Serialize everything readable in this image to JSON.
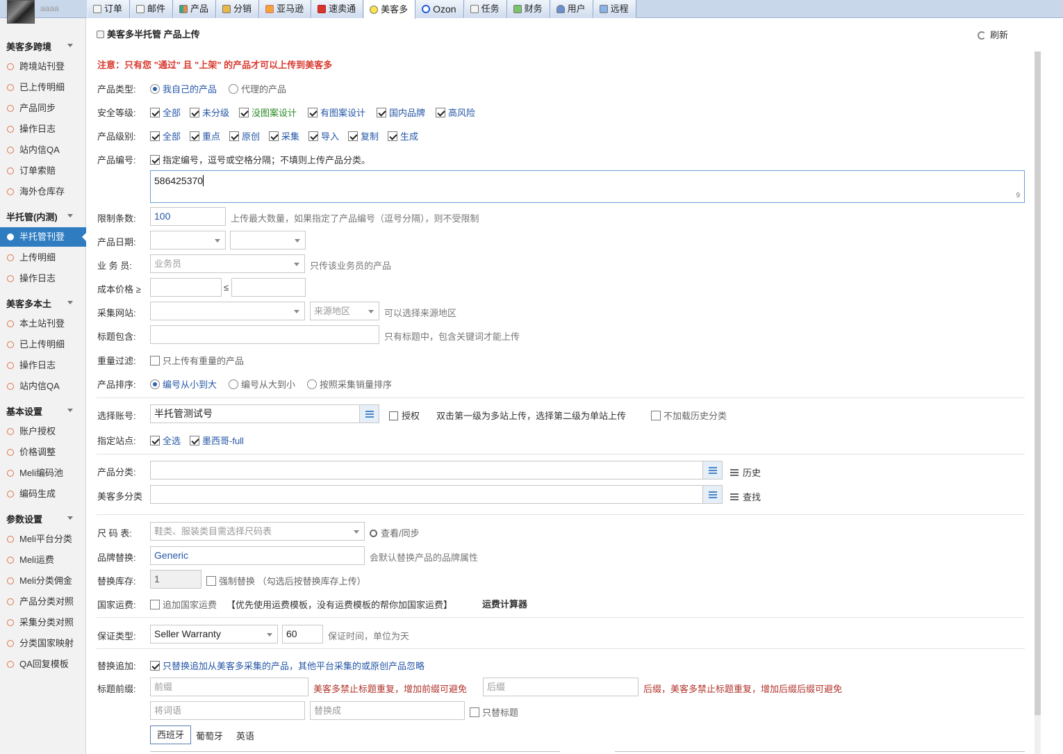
{
  "user": {
    "name": "aaaa"
  },
  "tabs": [
    {
      "label": "订单"
    },
    {
      "label": "邮件"
    },
    {
      "label": "产品"
    },
    {
      "label": "分销"
    },
    {
      "label": "亚马逊"
    },
    {
      "label": "速卖通"
    },
    {
      "label": "美客多",
      "active": true
    },
    {
      "label": "Ozon"
    },
    {
      "label": "任务"
    },
    {
      "label": "财务"
    },
    {
      "label": "用户"
    },
    {
      "label": "远程"
    }
  ],
  "sidebar": {
    "g1": "美客多跨境",
    "g1_items": [
      "跨境站刊登",
      "已上传明细",
      "产品同步",
      "操作日志",
      "站内信QA",
      "订单索赔",
      "海外仓库存"
    ],
    "g2": "半托管(内测)",
    "g2_items": [
      "半托管刊登",
      "上传明细",
      "操作日志"
    ],
    "g3": "美客多本土",
    "g3_items": [
      "本土站刊登",
      "已上传明细",
      "操作日志",
      "站内信QA"
    ],
    "g4": "基本设置",
    "g4_items": [
      "账户授权",
      "价格调整",
      "Meli编码池",
      "编码生成"
    ],
    "g5": "参数设置",
    "g5_items": [
      "Meli平台分类",
      "Meli运费",
      "Meli分类佣金",
      "产品分类对照",
      "采集分类对照",
      "分类国家映射",
      "QA回复模板"
    ]
  },
  "page": {
    "title": "美客多半托管 产品上传",
    "refresh": "刷新"
  },
  "form": {
    "notice": "注意：只有您 \"通过\" 且 \"上架\" 的产品才可以上传到美客多",
    "type_label": "产品类型:",
    "type_opt1": "我自己的产品",
    "type_opt2": "代理的产品",
    "safety_label": "安全等级:",
    "safety": [
      "全部",
      "未分级",
      "没图案设计",
      "有图案设计",
      "国内品牌",
      "高风险"
    ],
    "level_label": "产品级别:",
    "levels": [
      "全部",
      "重点",
      "原创",
      "采集",
      "导入",
      "复制",
      "生成"
    ],
    "code_label": "产品编号:",
    "code_check": "指定编号，逗号或空格分隔；不填则上传产品分类。",
    "code_value": "586425370",
    "code_count": "9",
    "limit_label": "限制条数:",
    "limit_value": "100",
    "limit_hint": "上传最大数量，如果指定了产品编号（逗号分隔），则不受限制",
    "date_label": "产品日期:",
    "staff_label": "业 务 员:",
    "staff_ph": "业务员",
    "staff_hint": "只传该业务员的产品",
    "cost_label": "成本价格 ≥",
    "cost_le": "≤",
    "site_label": "采集网站:",
    "region_ph": "来源地区",
    "region_hint": "可以选择来源地区",
    "title_label": "标题包含:",
    "title_hint": "只有标题中，包含关键词才能上传",
    "weight_label": "重量过滤:",
    "weight_check": "只上传有重量的产品",
    "sort_label": "产品排序:",
    "sort_opts": [
      "编号从小到大",
      "编号从大到小",
      "按照采集销量排序"
    ],
    "account_label": "选择账号:",
    "account_value": "半托管测试号",
    "auth": "授权",
    "account_hint": "双击第一级为多站上传，选择第二级为单站上传",
    "no_history": "不加载历史分类",
    "station_label": "指定站点:",
    "station_all": "全选",
    "station_mx": "墨西哥-full",
    "cat_label": "产品分类:",
    "history": "历史",
    "mcat_label": "美客多分类",
    "find": "查找",
    "size_label": "尺 码 表:",
    "size_ph": "鞋类、服装类目需选择尺码表",
    "size_view": "查看/同步",
    "brand_label": "品牌替换:",
    "brand_value": "Generic",
    "brand_hint": "会默认替换产品的品牌属性",
    "stock_label": "替换库存:",
    "stock_value": "1",
    "stock_check": "强制替换 （勾选后按替换库存上传）",
    "ship_label": "国家运费:",
    "ship_check": "追加国家运费",
    "ship_hint": "【优先使用运费模板，没有运费模板的帮你加国家运费】",
    "ship_calc": "运费计算器",
    "warranty_label": "保证类型:",
    "warranty_value": "Seller Warranty",
    "warranty_days": "60",
    "warranty_hint": "保证时间，单位为天",
    "replace_label": "替换追加:",
    "replace_check": "只替换追加从美客多采集的产品，其他平台采集的或原创产品忽略",
    "prefix_label": "标题前缀:",
    "prefix_ph": "前缀",
    "prefix_hint": "美客多禁止标题重复，增加前缀可避免",
    "suffix_ph": "后缀",
    "suffix_hint": "后缀，美客多禁止标题重复，增加后缀后缀可避免",
    "word_ph": "将词语",
    "replace_ph": "替换成",
    "only_title": "只替标题",
    "langs": [
      "西班牙",
      "葡萄牙",
      "英语"
    ]
  }
}
